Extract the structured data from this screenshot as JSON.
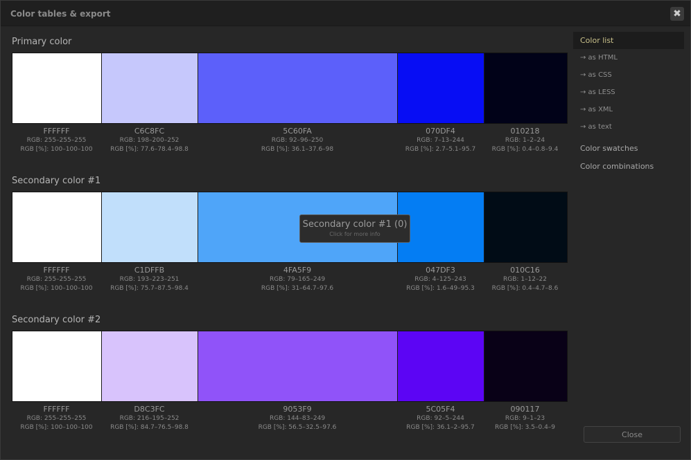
{
  "window": {
    "title": "Color tables & export",
    "close_icon": "close-icon"
  },
  "sections": [
    {
      "title": "Primary color",
      "swatches": [
        {
          "hex": "FFFFFF",
          "rgb": "RGB: 255–255–255",
          "rgbp": "RGB [%]: 100–100–100",
          "color": "#FFFFFF"
        },
        {
          "hex": "C6C8FC",
          "rgb": "RGB: 198–200–252",
          "rgbp": "RGB [%]: 77.6–78.4–98.8",
          "color": "#C6C8FC"
        },
        {
          "hex": "5C60FA",
          "rgb": "RGB: 92–96–250",
          "rgbp": "RGB [%]: 36.1–37.6–98",
          "color": "#5C60FA"
        },
        {
          "hex": "070DF4",
          "rgb": "RGB: 7–13–244",
          "rgbp": "RGB [%]: 2.7–5.1–95.7",
          "color": "#070DF4"
        },
        {
          "hex": "010218",
          "rgb": "RGB: 1–2–24",
          "rgbp": "RGB [%]: 0.4–0.8–9.4",
          "color": "#010218"
        }
      ]
    },
    {
      "title": "Secondary color #1",
      "swatches": [
        {
          "hex": "FFFFFF",
          "rgb": "RGB: 255–255–255",
          "rgbp": "RGB [%]: 100–100–100",
          "color": "#FFFFFF"
        },
        {
          "hex": "C1DFFB",
          "rgb": "RGB: 193–223–251",
          "rgbp": "RGB [%]: 75.7–87.5–98.4",
          "color": "#C1DFFB"
        },
        {
          "hex": "4FA5F9",
          "rgb": "RGB: 79–165–249",
          "rgbp": "RGB [%]: 31–64.7–97.6",
          "color": "#4FA5F9"
        },
        {
          "hex": "047DF3",
          "rgb": "RGB: 4–125–243",
          "rgbp": "RGB [%]: 1.6–49–95.3",
          "color": "#047DF3"
        },
        {
          "hex": "010C16",
          "rgb": "RGB: 1–12–22",
          "rgbp": "RGB [%]: 0.4–4.7–8.6",
          "color": "#010C16"
        }
      ]
    },
    {
      "title": "Secondary color #2",
      "swatches": [
        {
          "hex": "FFFFFF",
          "rgb": "RGB: 255–255–255",
          "rgbp": "RGB [%]: 100–100–100",
          "color": "#FFFFFF"
        },
        {
          "hex": "D8C3FC",
          "rgb": "RGB: 216–195–252",
          "rgbp": "RGB [%]: 84.7–76.5–98.8",
          "color": "#D8C3FC"
        },
        {
          "hex": "9053F9",
          "rgb": "RGB: 144–83–249",
          "rgbp": "RGB [%]: 56.5–32.5–97.6",
          "color": "#9053F9"
        },
        {
          "hex": "5C05F4",
          "rgb": "RGB: 92–5–244",
          "rgbp": "RGB [%]: 36.1–2–95.7",
          "color": "#5C05F4"
        },
        {
          "hex": "090117",
          "rgb": "RGB: 9–1–23",
          "rgbp": "RGB [%]: 3.5–0.4–9",
          "color": "#090117"
        }
      ]
    }
  ],
  "tooltip": {
    "title": "Secondary color #1 (0)",
    "subtitle": "Click for more info"
  },
  "sidebar": {
    "items": [
      {
        "label": "Color list"
      },
      {
        "label": "→ as HTML"
      },
      {
        "label": "→ as CSS"
      },
      {
        "label": "→ as LESS"
      },
      {
        "label": "→ as XML"
      },
      {
        "label": "→ as text"
      },
      {
        "label": "Color swatches"
      },
      {
        "label": "Color combinations"
      }
    ]
  },
  "footer": {
    "close_label": "Close"
  },
  "colors": {
    "background": "#272727",
    "accent": "#c9c08a"
  }
}
